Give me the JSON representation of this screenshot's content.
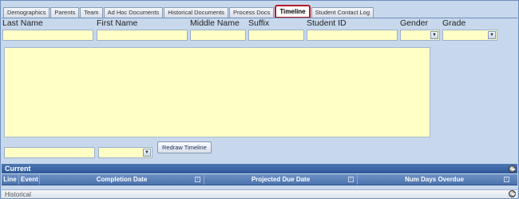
{
  "tabs": [
    {
      "label": "Demographics",
      "active": false
    },
    {
      "label": "Parents",
      "active": false
    },
    {
      "label": "Team",
      "active": false
    },
    {
      "label": "Ad Hoc Documents",
      "active": false
    },
    {
      "label": "Historical Documents",
      "active": false
    },
    {
      "label": "Process Docs",
      "active": false
    },
    {
      "label": "Timeline",
      "active": true
    },
    {
      "label": "Student Contact Log",
      "active": false
    }
  ],
  "header_fields": {
    "last_name_label": "Last Name",
    "first_name_label": "First Name",
    "middle_name_label": "Middle Name",
    "suffix_label": "Suffix",
    "student_id_label": "Student ID",
    "gender_label": "Gender",
    "grade_label": "Grade"
  },
  "timeline": {
    "redraw_label": "Redraw Timeline"
  },
  "current_panel": {
    "title": "Current",
    "columns": [
      "Line",
      "Event",
      "Completion Date",
      "Projected Due Date",
      "Num Days Overdue"
    ]
  },
  "historical_panel": {
    "title": "Historical"
  },
  "colors": {
    "field_bg": "#ffffc6",
    "panel_header": "#2d5798",
    "active_tab_border": "#b01e28",
    "page_bg": "#c7d8ec"
  },
  "icons": [
    "dropdown-arrow-icon",
    "sort-icon",
    "expand-circle-icon"
  ]
}
